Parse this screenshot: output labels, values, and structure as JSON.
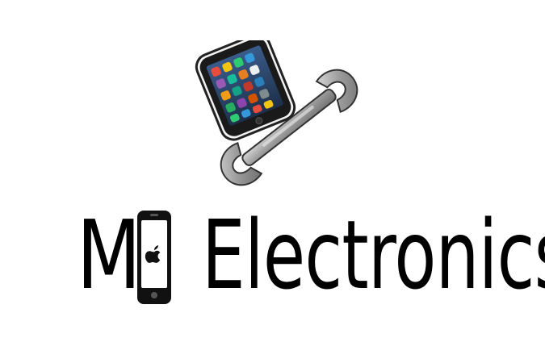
{
  "brand": {
    "word_before_icon": "M",
    "word_after_icon": "Electronics"
  },
  "icons": {
    "smartphone": "smartphone-icon",
    "wrench": "wrench-icon",
    "phone_in_wordmark": "phone-icon",
    "apple_logo": "apple-logo-icon"
  },
  "colors": {
    "text": "#000000",
    "background": "#ffffff",
    "wrench_metal": "#8e8e8e",
    "phone_body": "#1a1a1a",
    "phone_screen": "#2c3e50"
  }
}
